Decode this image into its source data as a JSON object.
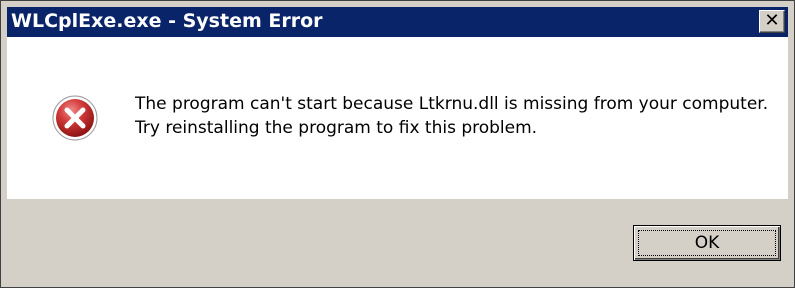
{
  "window": {
    "title": "WLCplExe.exe - System Error",
    "close_glyph": "✕",
    "close_icon": "close-icon"
  },
  "dialog": {
    "icon": "error-icon",
    "icon_color": "#c0282b",
    "message": "The program can't start because Ltkrnu.dll is missing from your computer. Try reinstalling the program to fix this problem.",
    "ok_label": "OK"
  }
}
